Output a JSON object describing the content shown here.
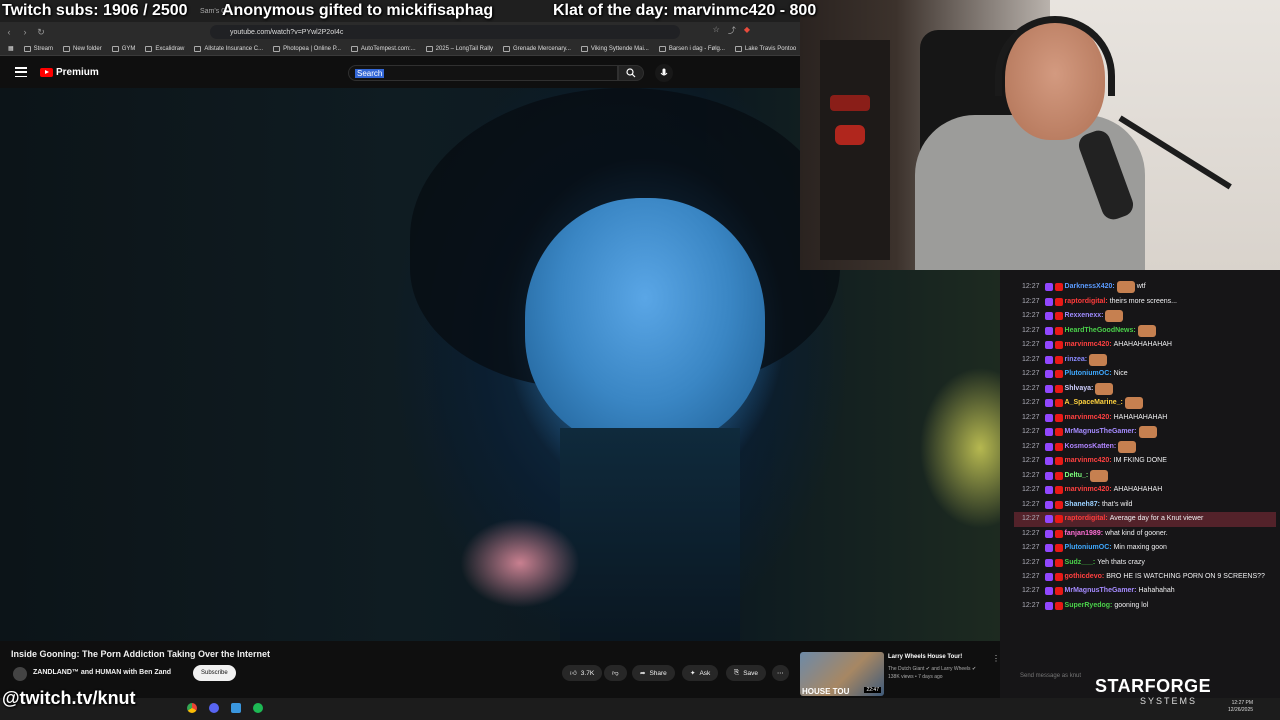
{
  "overlay": {
    "subs": "Twitch subs: 1906 / 2500",
    "gift": "Anonymous gifted to mickifisaphag",
    "klat": "Klat of the day: marvinmc420 - 800",
    "twitch_url": "@twitch.tv/knut",
    "sponsor": "STARFORGE",
    "sponsor_sub": "SYSTEMS"
  },
  "browser": {
    "tabs": [
      "Sam's Cl..."
    ],
    "url": "youtube.com/watch?v=PYwl2P2oI4c",
    "bookmarks": [
      "Stream",
      "New folder",
      "GYM",
      "Excalidraw",
      "Allstate Insurance C...",
      "Photopea | Online P...",
      "AutoTempest.com:...",
      "2025 – LongTail Rally",
      "Grenade Mercenary...",
      "Viking Syttende Mai...",
      "Barsen i dag - Følg...",
      "Lake Travis Pontoo"
    ]
  },
  "youtube": {
    "brand": "Premium",
    "search_value": "Search",
    "video_title": "Inside Gooning: The Porn Addiction Taking Over the Internet",
    "channel": "ZANDLAND™ and HUMAN with Ben Zand",
    "subscribe": "Subscribe",
    "likes": "3.7K",
    "share": "Share",
    "ask": "Ask",
    "save": "Save",
    "related": {
      "title": "Larry Wheels House Tour!",
      "channel": "The Dutch Giant ✔ and Larry Wheels ✔",
      "meta": "138K views • 7 days ago",
      "duration": "22:47",
      "thumb_text": "HOUSE TOU"
    }
  },
  "chat": {
    "messages": [
      {
        "ts": "12:27",
        "user": "DarknessX420:",
        "color": "#5b9bff",
        "text": "wtf",
        "emote": true
      },
      {
        "ts": "12:27",
        "user": "raptordigital:",
        "color": "#ff3b3b",
        "text": "theirs more screens..."
      },
      {
        "ts": "12:27",
        "user": "Rexxenexx:",
        "color": "#9f8cff",
        "text": "",
        "emote": true
      },
      {
        "ts": "12:27",
        "user": "HeardTheGoodNews:",
        "color": "#4ad04a",
        "text": "",
        "emote": true
      },
      {
        "ts": "12:27",
        "user": "marvinmc420:",
        "color": "#ff4040",
        "text": "AHAHAHAHAHAH"
      },
      {
        "ts": "12:27",
        "user": "rinzea:",
        "color": "#8a8aff",
        "text": "",
        "emote": true
      },
      {
        "ts": "12:27",
        "user": "PlutoniumOC:",
        "color": "#3fa9ff",
        "text": "Nice"
      },
      {
        "ts": "12:27",
        "user": "Shlvaya:",
        "color": "#d0d0ff",
        "text": "",
        "emote": true
      },
      {
        "ts": "12:27",
        "user": "A_SpaceMarine_:",
        "color": "#ffd23f",
        "text": "",
        "emote": true
      },
      {
        "ts": "12:27",
        "user": "marvinmc420:",
        "color": "#ff4040",
        "text": "HAHAHAHAHAH"
      },
      {
        "ts": "12:27",
        "user": "MrMagnusTheGamer:",
        "color": "#a58bff",
        "text": "",
        "emote": true
      },
      {
        "ts": "12:27",
        "user": "KosmosKatten:",
        "color": "#b085ff",
        "text": "",
        "emote": true
      },
      {
        "ts": "12:27",
        "user": "marvinmc420:",
        "color": "#ff4040",
        "text": "IM FKING DONE"
      },
      {
        "ts": "12:27",
        "user": "Deltu_:",
        "color": "#7cff7c",
        "text": "",
        "emote": true
      },
      {
        "ts": "12:27",
        "user": "marvinmc420:",
        "color": "#ff4040",
        "text": "AHAHAHAHAH"
      },
      {
        "ts": "12:27",
        "user": "Shaneh87:",
        "color": "#9ad0ff",
        "text": "that's wild"
      },
      {
        "ts": "12:27",
        "user": "raptordigital:",
        "color": "#ff3b3b",
        "text": "Average day for a Knut viewer",
        "highlight": true
      },
      {
        "ts": "12:27",
        "user": "fanjan1989:",
        "color": "#ff6fd6",
        "text": "what kind of gooner."
      },
      {
        "ts": "12:27",
        "user": "PlutoniumOC:",
        "color": "#3fa9ff",
        "text": "Min maxing goon"
      },
      {
        "ts": "12:27",
        "user": "Sudz___:",
        "color": "#4ad04a",
        "text": "Yeh thats crazy"
      },
      {
        "ts": "12:27",
        "user": "gothicdevo:",
        "color": "#ff4040",
        "text": "BRO HE IS WATCHING PORN ON 9 SCREENS??",
        "wrap": true
      },
      {
        "ts": "12:27",
        "user": "MrMagnusTheGamer:",
        "color": "#a58bff",
        "text": "Hahahahah"
      },
      {
        "ts": "12:27",
        "user": "SuperRyedog:",
        "color": "#4ad04a",
        "text": "gooning lol"
      }
    ],
    "input_placeholder": "Send message as knut"
  },
  "taskbar": {
    "time": "12:27 PM",
    "date": "12/26/2025"
  }
}
